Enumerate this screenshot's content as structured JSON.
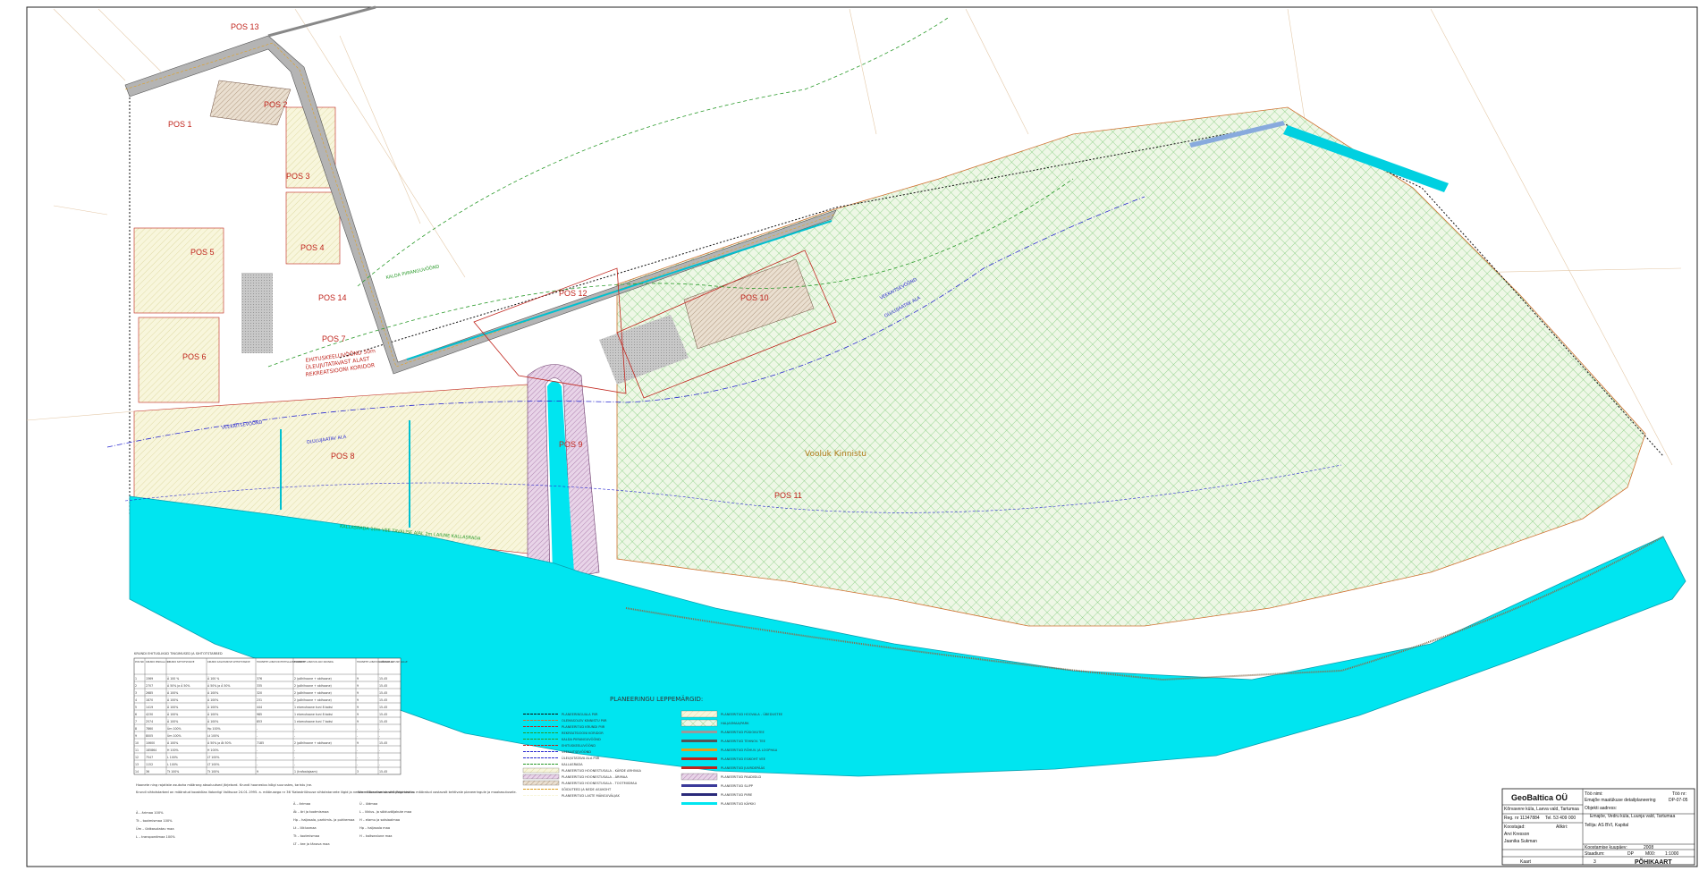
{
  "positions": {
    "pos1": "POS 1",
    "pos2": "POS 2",
    "pos3": "POS 3",
    "pos4": "POS 4",
    "pos5": "POS 5",
    "pos6": "POS 6",
    "pos7": "POS 7",
    "pos8": "POS 8",
    "pos9": "POS 9",
    "pos10": "POS 10",
    "pos11": "POS 11",
    "pos12": "POS 12",
    "pos13": "POS 13",
    "pos14": "POS 14"
  },
  "annotations": {
    "kalda_piirang": "KALDA PIIRANGUVÖÖND",
    "veekaitse_left": "VEEKAITSEVÖÖND",
    "veekaitse_right": "VEEKAITSEVÖÖND",
    "elluj_left": "OLULUJAATAV ALA",
    "elluj_right": "OLULUJAATAV ALA",
    "ehitus_1": "EHITUSKEELUVÖÖND 50m",
    "ehitus_2": "ÜLEUJUTATAVAST ALAST",
    "ehitus_3": "REKREATSIOONI KORIDOR",
    "kallasrada": "KALLASRADA 10m VEE TAVALISE AJAL 2m LAIUNE KALLASRADA",
    "vooluk": "Vooluk Kinnistu"
  },
  "legend": {
    "title": "PLANEERINGU LEPPEMÄRGID:",
    "left": [
      "PLANEERINGUALA PIIR",
      "OLEMASOLEV KINNISTU PIIR",
      "PLANEERITUD KRUNDI PIIR",
      "REKREATSIOONI KORIDOR",
      "KALDA PIIRANGUVÖÖND",
      "EHITUSKEELUVÖÖND",
      "VEEKAITSEVÖÖND",
      "ÜLEUJUTATAVA ALA PIIR",
      "KALLASRADA",
      "PLANEERITUD HOONESTUSALA - KÄRDE ARHIVAA",
      "PLANEERITUD HOONESTUSALA - ÄRIMAA",
      "PLANEERITUD HOONESTUSALA - TOOTMISMAA",
      "SÕIDUTEED JA NEDE ASUKOHT",
      "PLANEERITUD LASTE MÄNGUVÄLJAK"
    ],
    "right": [
      "PLANEERITUD HOOVALA - ÜBEDUSTEE",
      "HALJASMAA/PARK",
      "PLANEERITUD PÜSIOKUTEE",
      "PLANEERITUD TEHNOV. TEE",
      "PLANEERITUD RÕHUV. JA LOOPHAA",
      "PLANEERITUD ESIKOHT VEE",
      "PLANEERITUD JUURDEPÄÄS",
      "PLANEERITUD PAADISILD",
      "PLANEERITUD SLIPP",
      "PLANEERITUD PIIRE",
      "PLANEERITUD KÄYKKI"
    ]
  },
  "table": {
    "title": "KRUNDI EHITUSLIKUD TINGIMUSED JA SIHTOTSTARBED",
    "headers": [
      "POS NR",
      "KRUNDI PINDALA m²",
      "KRUNDI SIHTOTSTARVE",
      "KRUNDI KASUTAMISE SIHTOTSTARVE",
      "HOONETE LUBATUD EHITISALUNE PIND m²",
      "HOONETE LUBATUD ARV KRUNDIL",
      "HOONETE LUBATUD KÕRGUS m",
      "LUBATUD KATUSE KALLE"
    ],
    "rows": [
      [
        "1",
        "1569",
        "Ä 100 %",
        "Ä 100 %",
        "376",
        "2 (põhihoone + abihoone)",
        "9",
        "15-45"
      ],
      [
        "2",
        "2707",
        "Ä 50% ja Ä 50%",
        "Ä 50% ja Ä 50%",
        "335",
        "2 (põhihoone + abihoone)",
        "9",
        "15-45"
      ],
      [
        "3",
        "2685",
        "Ä 100%",
        "Ä 100%",
        "320",
        "2 (põhihoone + abihoone)",
        "9",
        "15-45"
      ],
      [
        "4",
        "1870",
        "Ä 100%",
        "Ä 100%",
        "231",
        "2 (põhihoone + abihoone)",
        "9",
        "15-45"
      ],
      [
        "5",
        "1419",
        "Ä 100%",
        "Ä 100%",
        "444",
        "1 elamuhoone kuni 8 boksi",
        "9",
        "15-45"
      ],
      [
        "6",
        "4230",
        "Ä 100%",
        "Ä 100%",
        "985",
        "1 elamuhoone kuni 8 boksi",
        "9",
        "15-45"
      ],
      [
        "7",
        "2574",
        "Ä 100%",
        "Ä 100%",
        "853",
        "1 elamuhoone kuni 7 boksi",
        "9",
        "15-45"
      ],
      [
        "8",
        "7860",
        "Üm 100%",
        "Hp 100%",
        "-",
        "-",
        "-",
        "-"
      ],
      [
        "9",
        "8005",
        "Üm 100%",
        "Lt 100%",
        "-",
        "-",
        "-",
        "-"
      ],
      [
        "10",
        "10600",
        "Ä 100%",
        "Ä 50% ja Ät 50%",
        "7185",
        "2 (põhihoone + abihoone)",
        "9",
        "15-45"
      ],
      [
        "11",
        "185864",
        "H 100%",
        "H 100%",
        "-",
        "-",
        "-",
        "-"
      ],
      [
        "12",
        "7547",
        "L 100%",
        "LT 100%",
        "-",
        "-",
        "-",
        "-"
      ],
      [
        "13",
        "1152",
        "L 100%",
        "LT 100%",
        "-",
        "-",
        "-",
        "-"
      ],
      [
        "14",
        "36",
        "Tt 100%",
        "Tt 100%",
        "9",
        "1 (trafoalajaam)",
        "3",
        "15-45"
      ]
    ]
  },
  "notes": {
    "n1": "Hoonete ning rajatiste asukoha määrang absoluutsed järjekord. Krundi hoonestus kõigi suurustes, taristu jne.",
    "n2": "Krundi sihtotstarbed on määratud kooskõlas Vabariigi Valitsuse 24.01.1995. a. määrusega nr 36 'Katastriüksuse sihtotstarvete liigid ja nende määramise alused' järgimiseks.",
    "n3": "Krundi kasutamise sihtotstarbed on määratud vastavalt kehtivale planeeringule ja maakasutusele."
  },
  "abbrev": {
    "col1": [
      "Ä – ärimaa 100%",
      "Tt – tootmismaa 100%",
      "Üm – üldkasutatav maa",
      "L – transpordimaa 100%"
    ],
    "col2": [
      "Ä – ärimaa",
      "Ät – äri ja tootmismaa",
      "Hp – haljasala, parkimis- ja puhkemaa",
      "Lt – liiklusmaa",
      "Tt – tootmismaa",
      "LT – tee ja tänava maa"
    ],
    "col3": [
      "Ü – üldmaa",
      "L – liiklus- ja sõiduväljakute maa",
      "H – elamu ja sotsiaalmaa",
      "Hp – haljasala maa",
      "H – kaitsealune maa"
    ]
  },
  "titleblock": {
    "company": "GeoBaltica OÜ",
    "address": "Kõrvavere küla, Laeva vald, Tartumaa",
    "reg": "Reg. nr 11347884",
    "tel": "Tel. 53 409 000",
    "work_name_label": "Töö nimi:",
    "work_name": "Emajõe maatükuse detailplaneering",
    "work_nr_label": "Töö nr:",
    "work_nr": "DP-07-05",
    "object_label": "Objekti aadress:",
    "object": "Emajõe, Vedru küla, Luunja vald, Tartumaa",
    "client": "Tellija: AS BVI, Kapital",
    "compiled_label": "Koostajad:",
    "compiler1": "Arvi Kresson",
    "compiler2": "Jaanika Sukman",
    "author_label": "Allkiri:",
    "date_label": "Koostamise kuupäev:",
    "date": "2008",
    "stage_label": "Staadium:",
    "stage": "DP",
    "scale_label": "M00:",
    "scale": "1:1000",
    "map_label": "Kaart",
    "map_nr": "3",
    "map_name": "PÕHIKAART"
  },
  "colors": {
    "water": "#00e5f0",
    "road": "#9a9a9a",
    "hatch_green": "#39b54a",
    "pos_red": "#c0241c",
    "boundary": "#d07030",
    "dash_green": "#2a9a2a",
    "dash_blue": "#2a2ad0"
  }
}
